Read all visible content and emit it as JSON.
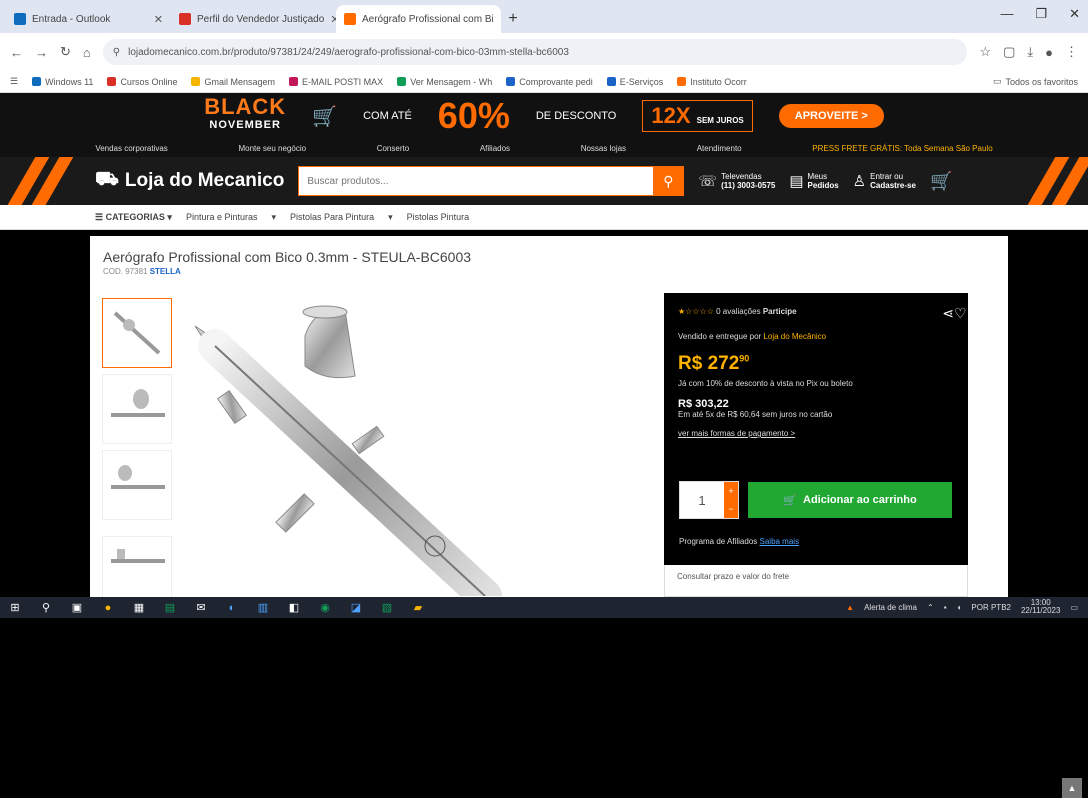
{
  "browser": {
    "tabs": [
      {
        "title": "Entrada - Outlook",
        "color": "#0f6cbd"
      },
      {
        "title": "Perfil do Vendedor Justiçado",
        "color": "#d93025"
      },
      {
        "title": "Aerógrafo Profissional com Bi",
        "color": "#ff6b00"
      }
    ],
    "url": "lojadomecanico.com.br/produto/97381/24/249/aerografo-profissional-com-bico-03mm-stella-bc6003",
    "bookmarks": [
      {
        "label": "Windows 11",
        "color": "#0f6cbd"
      },
      {
        "label": "Cursos Online",
        "color": "#d93025"
      },
      {
        "label": "Gmail Mensagem",
        "color": "#f4b400"
      },
      {
        "label": "E-MAIL POSTI MAX",
        "color": "#c2185b"
      },
      {
        "label": "Ver Mensagem - Wh",
        "color": "#0f9d58"
      },
      {
        "label": "Comprovante pedi",
        "color": "#1b63c7"
      },
      {
        "label": "E-Serviços",
        "color": "#1b63c7"
      },
      {
        "label": "Instituto Ocorr",
        "color": "#ff6b00"
      }
    ],
    "bookmarks_right": "Todos os favoritos"
  },
  "promo": {
    "black": "BLACK",
    "november": "NOVEMBER",
    "com_ate": "COM ATÉ",
    "percent": "60%",
    "desconto": "DE DESCONTO",
    "installments": "12X",
    "installments_note": "SEM JUROS",
    "cta": "APROVEITE >"
  },
  "topnav": [
    "Vendas corporativas",
    "Monte seu negócio",
    "Conserto",
    "Afiliados",
    "Nossas lojas",
    "Atendimento",
    "PRESS FRETE GRÁTIS: Toda Semana São Paulo"
  ],
  "header": {
    "logo": "Loja do Mecanico",
    "search_placeholder": "Buscar produtos...",
    "phone_label": "Televendas",
    "phone": "(11) 3003-0575",
    "orders_label": "Meus",
    "orders": "Pedidos",
    "account_label": "Entrar ou",
    "account": "Cadastre-se"
  },
  "categories": [
    "CATEGORIAS",
    "Pintura e Pinturas",
    "Pistolas Para Pintura",
    "Pistolas Pintura"
  ],
  "product": {
    "title": "Aerógrafo Profissional com Bico 0.3mm - STEULA-BC6003",
    "code_label": "COD. 97381",
    "brand": "STELLA",
    "rating_text": "0 avaliações",
    "rating_extra": "Participe",
    "sold_by": "Vendido e entregue por",
    "seller": "Loja do Mecânico",
    "price": "R$ 272",
    "price_cents": "90",
    "discount_note": "Já com 10% de desconto à vista no Pix ou boleto",
    "full_price": "R$ 303,22",
    "installment_note": "Em até 5x de R$ 60,64 sem juros no cartão",
    "payment_link": "ver mais formas de pagamento >",
    "qty": "1",
    "add_to_cart": "Adicionar ao carrinho",
    "affiliates": "Programa de Afiliados",
    "affiliates_link": "Saiba mais",
    "shipping": "Consultar prazo e valor do frete"
  },
  "taskbar": {
    "weather": "Alerta de clima",
    "lang": "POR PTB2",
    "time": "13:00",
    "date": "22/11/2023"
  }
}
